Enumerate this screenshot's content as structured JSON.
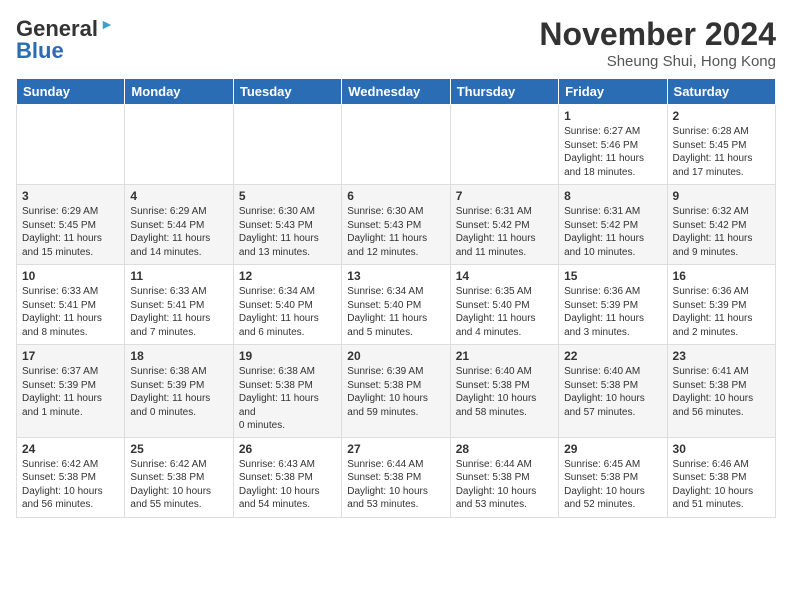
{
  "logo": {
    "line1": "General",
    "line2": "Blue",
    "arrow": true
  },
  "title": "November 2024",
  "subtitle": "Sheung Shui, Hong Kong",
  "days_of_week": [
    "Sunday",
    "Monday",
    "Tuesday",
    "Wednesday",
    "Thursday",
    "Friday",
    "Saturday"
  ],
  "weeks": [
    [
      {
        "day": "",
        "info": ""
      },
      {
        "day": "",
        "info": ""
      },
      {
        "day": "",
        "info": ""
      },
      {
        "day": "",
        "info": ""
      },
      {
        "day": "",
        "info": ""
      },
      {
        "day": "1",
        "info": "Sunrise: 6:27 AM\nSunset: 5:46 PM\nDaylight: 11 hours and 18 minutes."
      },
      {
        "day": "2",
        "info": "Sunrise: 6:28 AM\nSunset: 5:45 PM\nDaylight: 11 hours and 17 minutes."
      }
    ],
    [
      {
        "day": "3",
        "info": "Sunrise: 6:29 AM\nSunset: 5:45 PM\nDaylight: 11 hours and 15 minutes."
      },
      {
        "day": "4",
        "info": "Sunrise: 6:29 AM\nSunset: 5:44 PM\nDaylight: 11 hours and 14 minutes."
      },
      {
        "day": "5",
        "info": "Sunrise: 6:30 AM\nSunset: 5:43 PM\nDaylight: 11 hours and 13 minutes."
      },
      {
        "day": "6",
        "info": "Sunrise: 6:30 AM\nSunset: 5:43 PM\nDaylight: 11 hours and 12 minutes."
      },
      {
        "day": "7",
        "info": "Sunrise: 6:31 AM\nSunset: 5:42 PM\nDaylight: 11 hours and 11 minutes."
      },
      {
        "day": "8",
        "info": "Sunrise: 6:31 AM\nSunset: 5:42 PM\nDaylight: 11 hours and 10 minutes."
      },
      {
        "day": "9",
        "info": "Sunrise: 6:32 AM\nSunset: 5:42 PM\nDaylight: 11 hours and 9 minutes."
      }
    ],
    [
      {
        "day": "10",
        "info": "Sunrise: 6:33 AM\nSunset: 5:41 PM\nDaylight: 11 hours and 8 minutes."
      },
      {
        "day": "11",
        "info": "Sunrise: 6:33 AM\nSunset: 5:41 PM\nDaylight: 11 hours and 7 minutes."
      },
      {
        "day": "12",
        "info": "Sunrise: 6:34 AM\nSunset: 5:40 PM\nDaylight: 11 hours and 6 minutes."
      },
      {
        "day": "13",
        "info": "Sunrise: 6:34 AM\nSunset: 5:40 PM\nDaylight: 11 hours and 5 minutes."
      },
      {
        "day": "14",
        "info": "Sunrise: 6:35 AM\nSunset: 5:40 PM\nDaylight: 11 hours and 4 minutes."
      },
      {
        "day": "15",
        "info": "Sunrise: 6:36 AM\nSunset: 5:39 PM\nDaylight: 11 hours and 3 minutes."
      },
      {
        "day": "16",
        "info": "Sunrise: 6:36 AM\nSunset: 5:39 PM\nDaylight: 11 hours and 2 minutes."
      }
    ],
    [
      {
        "day": "17",
        "info": "Sunrise: 6:37 AM\nSunset: 5:39 PM\nDaylight: 11 hours and 1 minute."
      },
      {
        "day": "18",
        "info": "Sunrise: 6:38 AM\nSunset: 5:39 PM\nDaylight: 11 hours and 0 minutes."
      },
      {
        "day": "19",
        "info": "Sunrise: 6:38 AM\nSunset: 5:38 PM\nDaylight: 11 hours and\n0 minutes."
      },
      {
        "day": "20",
        "info": "Sunrise: 6:39 AM\nSunset: 5:38 PM\nDaylight: 10 hours and 59 minutes."
      },
      {
        "day": "21",
        "info": "Sunrise: 6:40 AM\nSunset: 5:38 PM\nDaylight: 10 hours and 58 minutes."
      },
      {
        "day": "22",
        "info": "Sunrise: 6:40 AM\nSunset: 5:38 PM\nDaylight: 10 hours and 57 minutes."
      },
      {
        "day": "23",
        "info": "Sunrise: 6:41 AM\nSunset: 5:38 PM\nDaylight: 10 hours and 56 minutes."
      }
    ],
    [
      {
        "day": "24",
        "info": "Sunrise: 6:42 AM\nSunset: 5:38 PM\nDaylight: 10 hours and 56 minutes."
      },
      {
        "day": "25",
        "info": "Sunrise: 6:42 AM\nSunset: 5:38 PM\nDaylight: 10 hours and 55 minutes."
      },
      {
        "day": "26",
        "info": "Sunrise: 6:43 AM\nSunset: 5:38 PM\nDaylight: 10 hours and 54 minutes."
      },
      {
        "day": "27",
        "info": "Sunrise: 6:44 AM\nSunset: 5:38 PM\nDaylight: 10 hours and 53 minutes."
      },
      {
        "day": "28",
        "info": "Sunrise: 6:44 AM\nSunset: 5:38 PM\nDaylight: 10 hours and 53 minutes."
      },
      {
        "day": "29",
        "info": "Sunrise: 6:45 AM\nSunset: 5:38 PM\nDaylight: 10 hours and 52 minutes."
      },
      {
        "day": "30",
        "info": "Sunrise: 6:46 AM\nSunset: 5:38 PM\nDaylight: 10 hours and 51 minutes."
      }
    ]
  ]
}
